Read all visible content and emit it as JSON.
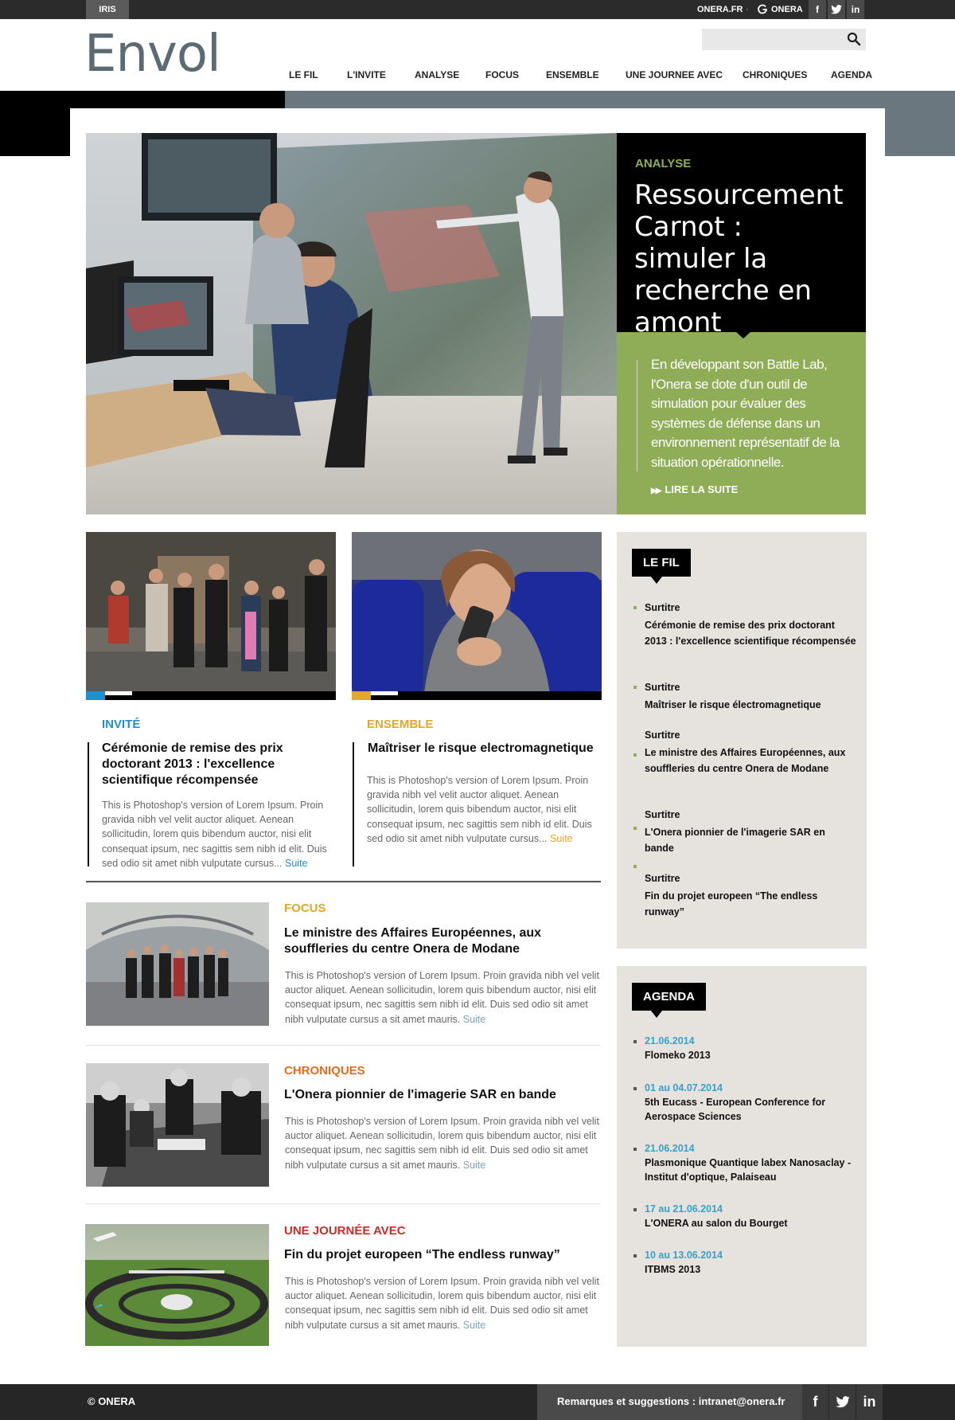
{
  "topbar": {
    "iris": "IRIS",
    "onera_fr": "ONERA.FR",
    "separator": "·",
    "onera": "ONERA",
    "social": [
      "f",
      "t",
      "in"
    ]
  },
  "header": {
    "logo": "Envol",
    "search_placeholder": "",
    "nav": [
      "LE FIL",
      "L'INVITE",
      "ANALYSE",
      "FOCUS",
      "ENSEMBLE",
      "UNE JOURNEE AVEC",
      "CHRONIQUES",
      "AGENDA"
    ]
  },
  "hero": {
    "category": "ANALYSE",
    "title": "Ressourcement Carnot : simuler la recherche en amont",
    "summary": "En développant son Battle Lab, l'Onera se dote d'un outil de simulation pour évaluer des systèmes de défense dans un environnement représentatif de la situation opérationnelle.",
    "more": "LIRE LA SUITE"
  },
  "cards": [
    {
      "category": "INVITÉ",
      "title": "Cérémonie de remise des prix doctorant 2013 : l'excellence scientifique récompensée",
      "body": "This is Photoshop's version  of Lorem Ipsum. Proin gravida nibh vel velit auctor aliquet. Aenean sollicitudin, lorem quis bibendum auctor, nisi elit consequat ipsum, nec sagittis sem nibh id elit. Duis sed odio sit amet nibh vulputate cursus...",
      "suite": "Suite"
    },
    {
      "category": "ENSEMBLE",
      "title": "Maîtriser le risque electromagnetique",
      "body": "This is Photoshop's version  of Lorem Ipsum. Proin gravida nibh vel velit auctor aliquet. Aenean sollicitudin, lorem quis bibendum auctor, nisi elit consequat ipsum, nec sagittis sem nibh id elit. Duis sed odio sit amet nibh vulputate cursus...",
      "suite": "Suite"
    }
  ],
  "articles": [
    {
      "category": "FOCUS",
      "title": "Le ministre des Affaires Européennes, aux souffleries du centre Onera de Modane",
      "body": "This is Photoshop's version  of Lorem Ipsum. Proin gravida nibh vel velit auctor aliquet. Aenean sollicitudin, lorem quis bibendum auctor, nisi elit consequat ipsum, nec sagittis sem nibh id elit. Duis sed odio sit amet nibh vulputate cursus a sit amet mauris.",
      "suite": "Suite"
    },
    {
      "category": "CHRONIQUES",
      "title": "L'Onera pionnier de l'imagerie SAR en bande",
      "body": "This is Photoshop's version  of Lorem Ipsum. Proin gravida nibh vel velit auctor aliquet. Aenean sollicitudin, lorem quis bibendum auctor, nisi elit consequat ipsum, nec sagittis sem nibh id elit. Duis sed odio sit amet nibh vulputate cursus a sit amet mauris.",
      "suite": "Suite"
    },
    {
      "category": "UNE JOURNÉE AVEC",
      "title": "Fin du projet europeen “The endless runway”",
      "body": "This is Photoshop's version  of Lorem Ipsum. Proin gravida nibh vel velit auctor aliquet. Aenean sollicitudin, lorem quis bibendum auctor, nisi elit consequat ipsum, nec sagittis sem nibh id elit. Duis sed odio sit amet nibh vulputate cursus a sit amet mauris.",
      "suite": "Suite"
    }
  ],
  "le_fil": {
    "label": "LE FIL",
    "items": [
      {
        "surtitre": "Surtitre",
        "title": "Cérémonie de remise des prix doctorant 2013 : l'excellence scientifique récompensée"
      },
      {
        "surtitre": "Surtitre",
        "title": "Maîtriser le risque électromagnetique"
      },
      {
        "surtitre": "Surtitre",
        "title": "Le ministre des Affaires Européennes, aux souffleries du centre Onera de Modane"
      },
      {
        "surtitre": "Surtitre",
        "title": "L'Onera pionnier de l'imagerie SAR en bande"
      },
      {
        "surtitre": "Surtitre",
        "title": "Fin du projet europeen “The endless runway”"
      }
    ]
  },
  "agenda": {
    "label": "AGENDA",
    "items": [
      {
        "date": "21.06.2014",
        "title": "Flomeko 2013"
      },
      {
        "date": "01 au 04.07.2014",
        "title": "5th Eucass - European Conference for Aerospace Sciences"
      },
      {
        "date": "21.06.2014",
        "title": "Plasmonique Quantique labex Nanosaclay - Institut d'optique, Palaiseau"
      },
      {
        "date": "17 au 21.06.2014",
        "title": "L'ONERA au salon du Bourget"
      },
      {
        "date": "10 au 13.06.2014",
        "title": "ITBMS 2013"
      }
    ]
  },
  "footer": {
    "copyright": "© ONERA",
    "feedback": "Remarques et suggestions : intranet@onera.fr",
    "social": [
      "f",
      "t",
      "in"
    ]
  },
  "colors": {
    "accent_green": "#8fad57",
    "invite_blue": "#1e8fd0",
    "ensemble_yellow": "#e2a72b",
    "focus_yellow": "#e3a72c",
    "chroniques_orange": "#e56b1f",
    "journee_red": "#cf2a2a",
    "agenda_date_blue": "#3aa0c7",
    "slate": "#6b777e"
  }
}
